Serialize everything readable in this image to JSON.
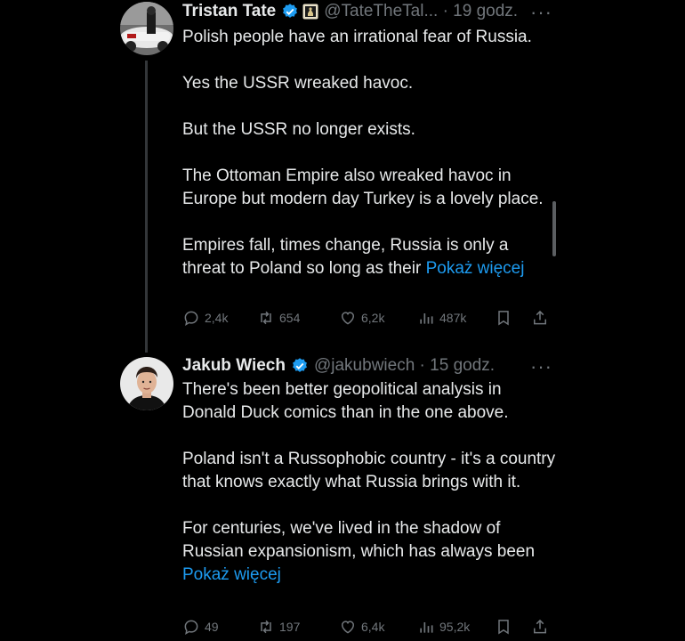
{
  "tweets": [
    {
      "author_name": "Tristan Tate",
      "handle_time": "@TateTheTal... · 19 godz.",
      "more": "···",
      "paragraphs": [
        "Polish people have an irrational fear of Russia.",
        "Yes the USSR wreaked havoc.",
        "But the USSR no longer exists.",
        "The Ottoman Empire also wreaked havoc in Europe but modern day Turkey is a lovely place.",
        "Empires fall, times change, Russia is only a threat to Poland so long as their"
      ],
      "show_more": "Pokaż więcej",
      "replies": "2,4k",
      "retweets": "654",
      "likes": "6,2k",
      "views": "487k"
    },
    {
      "author_name": "Jakub Wiech",
      "handle_time": "@jakubwiech · 15 godz.",
      "more": "···",
      "paragraphs": [
        "There's been better geopolitical analysis in Donald Duck comics than in the one above.",
        "Poland isn't a Russophobic country - it's a country that knows exactly what Russia brings with it.",
        "For centuries, we've lived in the shadow of Russian expansionism, which has always been"
      ],
      "show_more": "Pokaż więcej",
      "replies": "49",
      "retweets": "197",
      "likes": "6,4k",
      "views": "95,2k"
    }
  ],
  "icons": {
    "verified": "verified-badge-icon",
    "affiliate": "affiliate-badge-icon",
    "reply": "reply-icon",
    "retweet": "retweet-icon",
    "like": "heart-icon",
    "views": "views-chart-icon",
    "bookmark": "bookmark-icon",
    "share": "share-icon"
  },
  "colors": {
    "background": "#000000",
    "text": "#e7e9ea",
    "muted": "#71767b",
    "link": "#1d9bf0"
  }
}
